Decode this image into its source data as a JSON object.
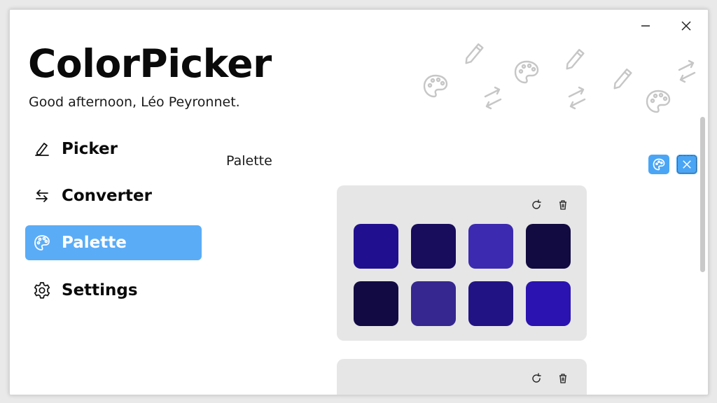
{
  "app": {
    "title": "ColorPicker",
    "greeting": "Good afternoon, Léo Peyronnet."
  },
  "window_controls": {
    "minimize_icon": "minimize-icon",
    "close_icon": "close-icon"
  },
  "nav": {
    "items": [
      {
        "label": "Picker",
        "icon": "pen-icon",
        "active": false
      },
      {
        "label": "Converter",
        "icon": "swap-arrows-icon",
        "active": false
      },
      {
        "label": "Palette",
        "icon": "palette-icon",
        "active": true
      },
      {
        "label": "Settings",
        "icon": "gear-icon",
        "active": false
      }
    ]
  },
  "page": {
    "title": "Palette"
  },
  "colors": {
    "accent": "#5aacf7",
    "card_bg": "#e6e6e6"
  },
  "palettes": [
    {
      "swatches": [
        "#20108f",
        "#180c5d",
        "#3c2ab0",
        "#120b41",
        "#120b43",
        "#35278f",
        "#221384",
        "#2a13b0"
      ]
    },
    {
      "swatches": []
    }
  ]
}
